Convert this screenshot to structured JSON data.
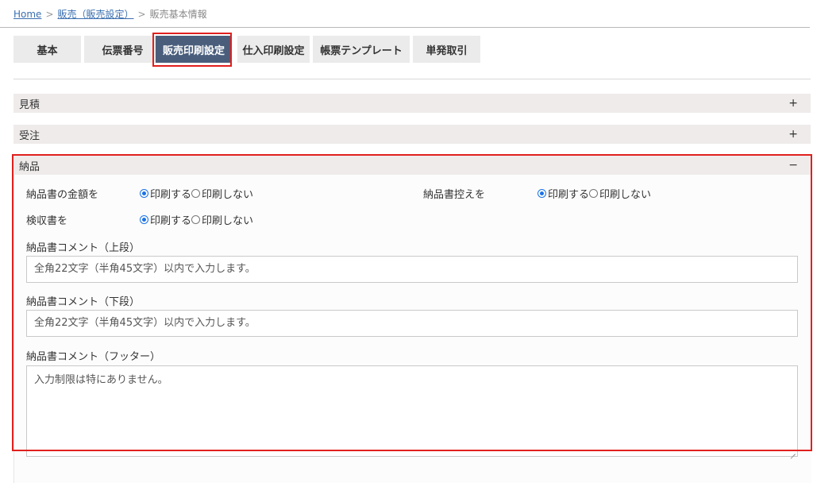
{
  "breadcrumb": {
    "home": "Home",
    "separator": ">",
    "parent": "販売（販売設定）",
    "current": "販売基本情報"
  },
  "tabs": [
    {
      "label": "基本",
      "active": false
    },
    {
      "label": "伝票番号",
      "active": false
    },
    {
      "label": "販売印刷設定",
      "active": true
    },
    {
      "label": "仕入印刷設定",
      "active": false
    },
    {
      "label": "帳票テンプレート",
      "active": false
    },
    {
      "label": "単発取引",
      "active": false
    }
  ],
  "sections": {
    "estimate": {
      "title": "見積",
      "toggle": "+"
    },
    "order": {
      "title": "受注",
      "toggle": "+"
    },
    "delivery": {
      "title": "納品",
      "toggle": "−"
    }
  },
  "delivery": {
    "amount_label": "納品書の金額を",
    "copy_label": "納品書控えを",
    "inspection_label": "検収書を",
    "option_print": "印刷する",
    "option_no_print": "印刷しない",
    "amount_value": "印刷する",
    "copy_value": "印刷する",
    "inspection_value": "印刷する",
    "comment_upper_label": "納品書コメント（上段）",
    "comment_upper_placeholder": "全角22文字（半角45文字）以内で入力します。",
    "comment_lower_label": "納品書コメント（下段）",
    "comment_lower_placeholder": "全角22文字（半角45文字）以内で入力します。",
    "comment_footer_label": "納品書コメント（フッター）",
    "comment_footer_placeholder": "入力制限は特にありません。"
  },
  "colors": {
    "active_tab": "#4a5e7c",
    "highlight": "#e0201e",
    "link": "#3a6fb0",
    "radio": "#1a73e8"
  }
}
